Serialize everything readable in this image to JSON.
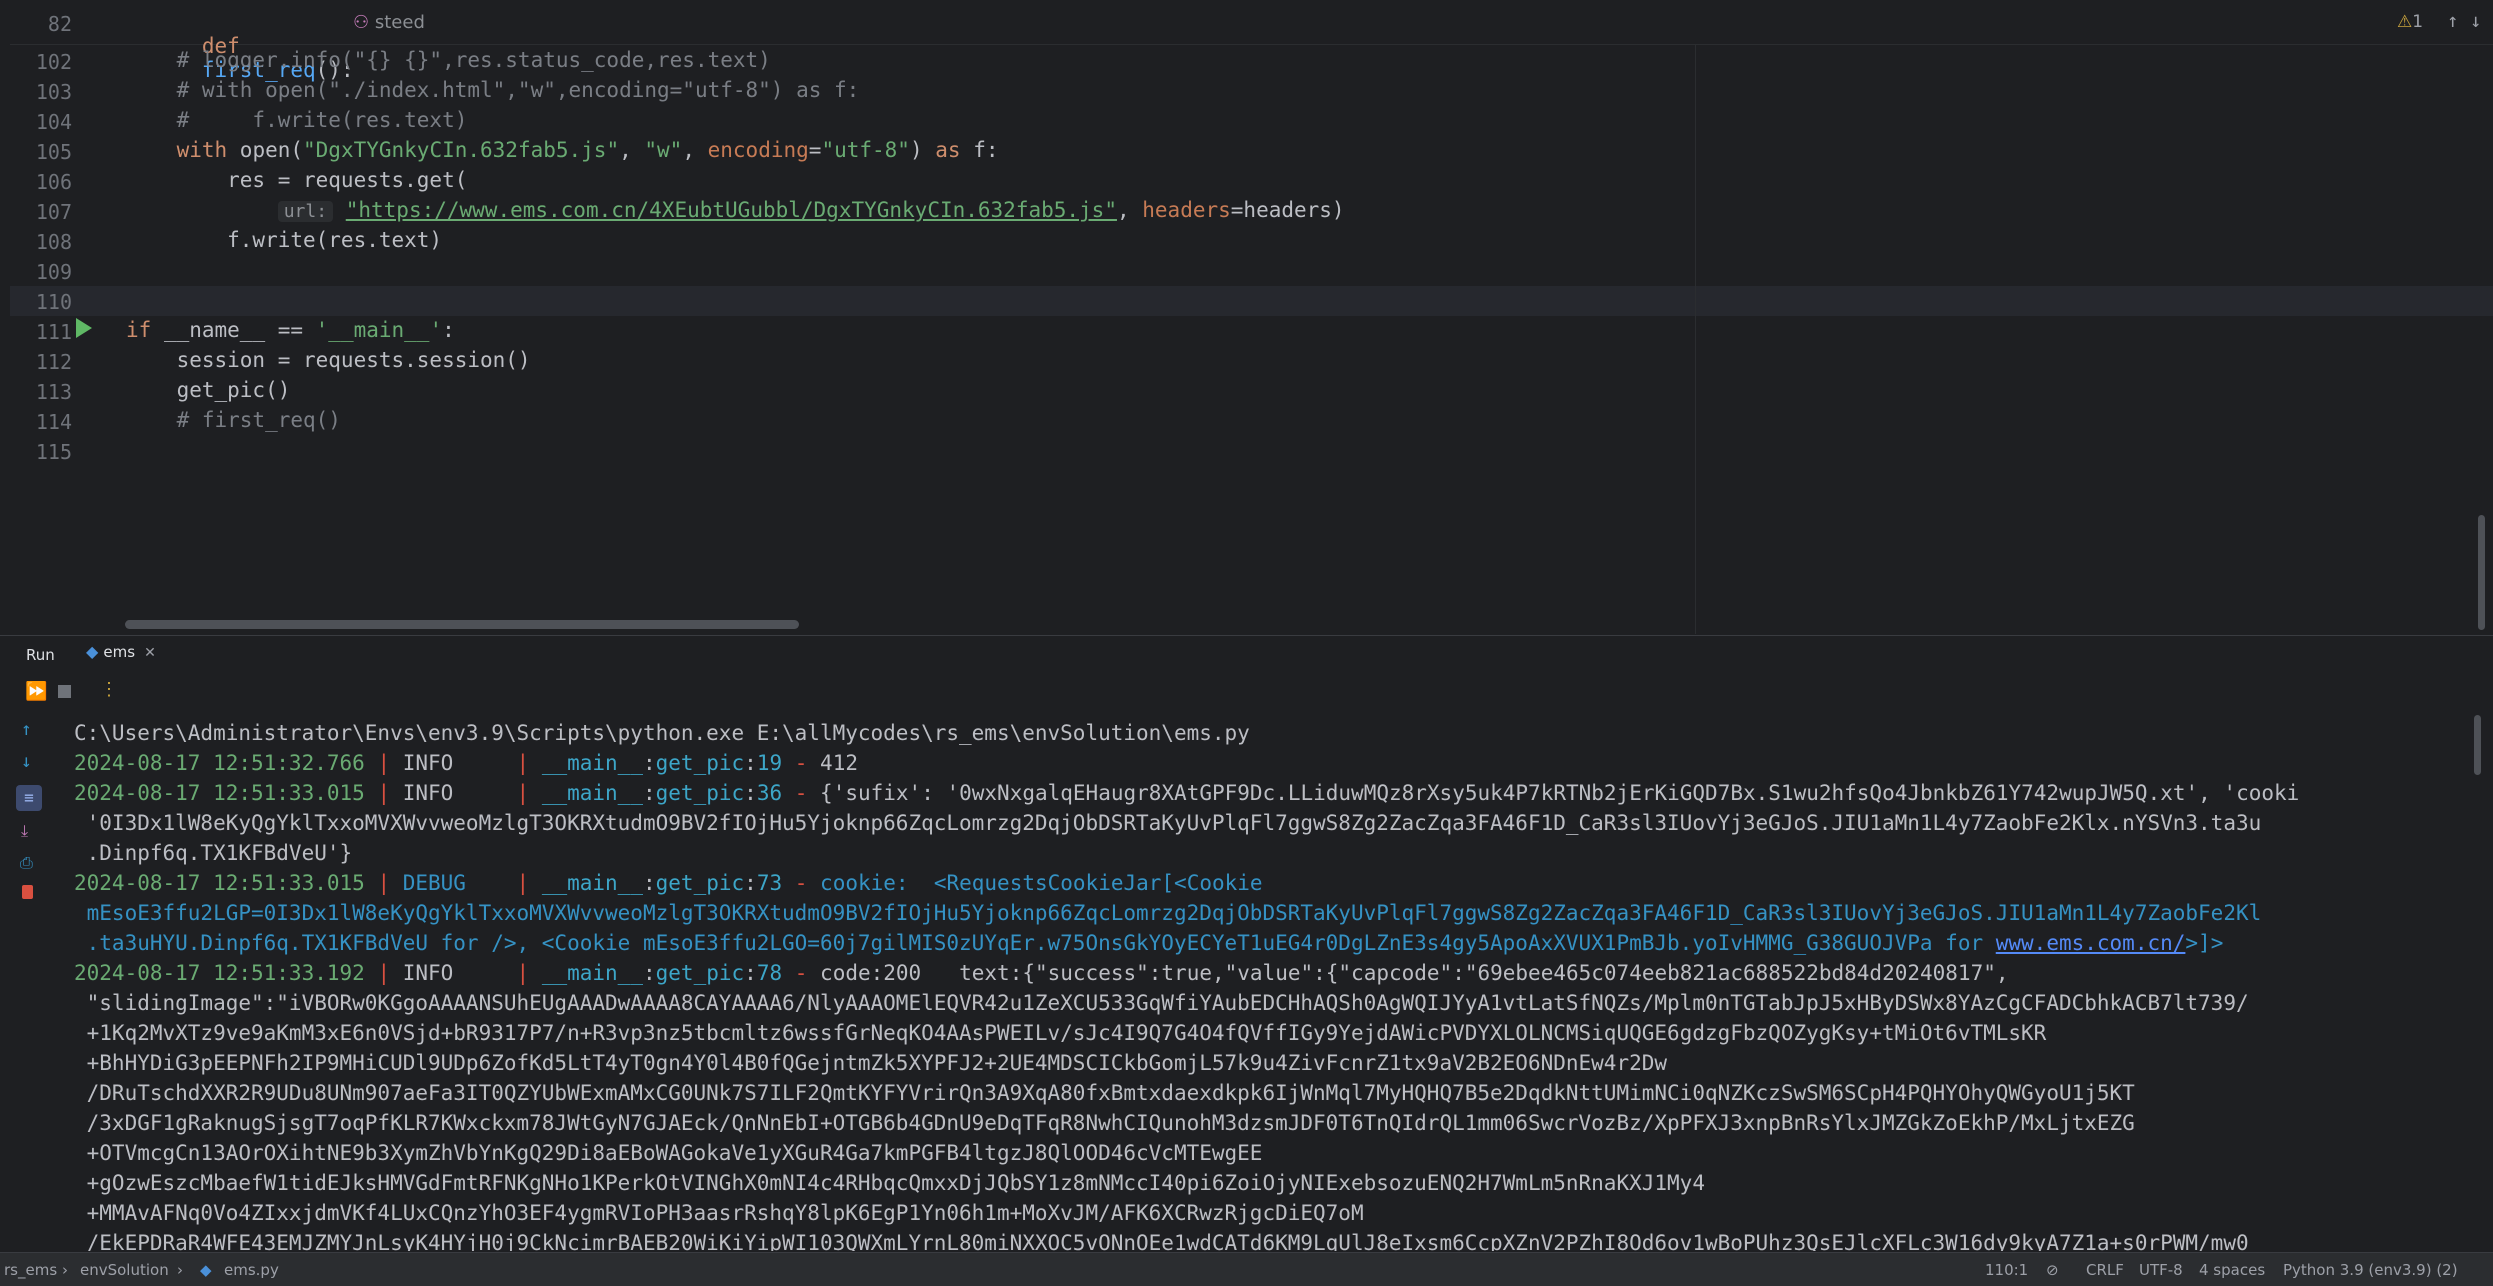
{
  "sticky": {
    "line_number": "82",
    "def_kw": "def",
    "func_name": "first_req",
    "suffix": "():",
    "author": "steed",
    "warning_count": "1"
  },
  "code_lines": [
    {
      "n": "102",
      "parts": [
        {
          "t": "    # logger.info(\"{} {}\",res.status_code,res.text)",
          "c": "cm"
        }
      ]
    },
    {
      "n": "103",
      "parts": [
        {
          "t": "    # with open(\"./index.html\",\"w\",encoding=\"utf-8\") as f:",
          "c": "cm"
        }
      ]
    },
    {
      "n": "104",
      "parts": [
        {
          "t": "    #     f.write(res.text)",
          "c": "cm"
        }
      ]
    },
    {
      "n": "105",
      "parts": [
        {
          "t": "    ",
          "c": ""
        },
        {
          "t": "with ",
          "c": "kw"
        },
        {
          "t": "open(",
          "c": ""
        },
        {
          "t": "\"DgxTYGnkyCIn.632fab5.js\"",
          "c": "str"
        },
        {
          "t": ", ",
          "c": ""
        },
        {
          "t": "\"w\"",
          "c": "str"
        },
        {
          "t": ", ",
          "c": ""
        },
        {
          "t": "encoding",
          "c": "kwarg"
        },
        {
          "t": "=",
          "c": ""
        },
        {
          "t": "\"utf-8\"",
          "c": "str"
        },
        {
          "t": ") ",
          "c": ""
        },
        {
          "t": "as ",
          "c": "kw"
        },
        {
          "t": "f:",
          "c": ""
        }
      ]
    },
    {
      "n": "106",
      "parts": [
        {
          "t": "        res = requests.get(",
          "c": ""
        }
      ]
    },
    {
      "n": "107",
      "parts": [
        {
          "t": "            ",
          "c": ""
        },
        {
          "t": "url:",
          "c": "hint"
        },
        {
          "t": " ",
          "c": ""
        },
        {
          "t": "\"https://www.ems.com.cn/4XEubtUGubbl/DgxTYGnkyCIn.632fab5.js\"",
          "c": "url"
        },
        {
          "t": ", ",
          "c": ""
        },
        {
          "t": "headers",
          "c": "kwarg"
        },
        {
          "t": "=headers)",
          "c": ""
        }
      ]
    },
    {
      "n": "108",
      "parts": [
        {
          "t": "        f.write(res.text)",
          "c": ""
        }
      ]
    },
    {
      "n": "109",
      "parts": []
    },
    {
      "n": "110",
      "parts": []
    },
    {
      "n": "111",
      "parts": [
        {
          "t": "if ",
          "c": "kw"
        },
        {
          "t": "__name__ == ",
          "c": ""
        },
        {
          "t": "'__main__'",
          "c": "str"
        },
        {
          "t": ":",
          "c": ""
        }
      ]
    },
    {
      "n": "112",
      "parts": [
        {
          "t": "    session = requests.session()",
          "c": ""
        }
      ]
    },
    {
      "n": "113",
      "parts": [
        {
          "t": "    get_pic()",
          "c": ""
        }
      ]
    },
    {
      "n": "114",
      "parts": [
        {
          "t": "    # first_req()",
          "c": "cm"
        }
      ]
    },
    {
      "n": "115",
      "parts": []
    }
  ],
  "run_panel": {
    "tab_run": "Run",
    "tab_ems": "ems"
  },
  "console_lines": [
    [
      {
        "t": "C:\\Users\\Administrator\\Envs\\env3.9\\Scripts\\python.exe E:\\allMycodes\\rs_ems\\envSolution\\ems.py",
        "c": ""
      }
    ],
    [
      {
        "t": "2024-08-17 12:51:32.766",
        "c": "ts"
      },
      {
        "t": " | ",
        "c": "sep"
      },
      {
        "t": "INFO    ",
        "c": "lvl"
      },
      {
        "t": " | ",
        "c": "sep"
      },
      {
        "t": "__main__",
        "c": "mod"
      },
      {
        "t": ":",
        "c": ""
      },
      {
        "t": "get_pic",
        "c": "mod"
      },
      {
        "t": ":",
        "c": ""
      },
      {
        "t": "19",
        "c": "mod"
      },
      {
        "t": " - ",
        "c": "sep"
      },
      {
        "t": "412",
        "c": ""
      }
    ],
    [
      {
        "t": "2024-08-17 12:51:33.015",
        "c": "ts"
      },
      {
        "t": " | ",
        "c": "sep"
      },
      {
        "t": "INFO    ",
        "c": "lvl"
      },
      {
        "t": " | ",
        "c": "sep"
      },
      {
        "t": "__main__",
        "c": "mod"
      },
      {
        "t": ":",
        "c": ""
      },
      {
        "t": "get_pic",
        "c": "mod"
      },
      {
        "t": ":",
        "c": ""
      },
      {
        "t": "36",
        "c": "mod"
      },
      {
        "t": " - ",
        "c": "sep"
      },
      {
        "t": "{'sufix': '0wxNxgalqEHaugr8XAtGPF9Dc.LLiduwMQz8rXsy5uk4P7kRTNb2jErKiGQD7Bx.S1wu2hfsQo4JbnkbZ61Y742wupJW5Q.xt', 'cooki",
        "c": ""
      }
    ],
    [
      {
        "t": " '0I3Dx1lW8eKyQgYklTxxoMVXWvvweoMzlgT3OKRXtudmO9BV2fIOjHu5Yjoknp66ZqcLomrzg2DqjObDSRTaKyUvPlqFl7ggwS8Zg2ZacZqa3FA46F1D_CaR3sl3IUovYj3eGJoS.JIU1aMn1L4y7ZaobFe2Klx.nYSVn3.ta3u",
        "c": ""
      }
    ],
    [
      {
        "t": " .Dinpf6q.TX1KFBdVeU'}",
        "c": ""
      }
    ],
    [
      {
        "t": "2024-08-17 12:51:33.015",
        "c": "ts"
      },
      {
        "t": " | ",
        "c": "sep"
      },
      {
        "t": "DEBUG   ",
        "c": "dbg"
      },
      {
        "t": " | ",
        "c": "sep"
      },
      {
        "t": "__main__",
        "c": "mod"
      },
      {
        "t": ":",
        "c": ""
      },
      {
        "t": "get_pic",
        "c": "mod"
      },
      {
        "t": ":",
        "c": ""
      },
      {
        "t": "73",
        "c": "mod"
      },
      {
        "t": " - ",
        "c": "sep"
      },
      {
        "t": "cookie:  <RequestsCookieJar[<Cookie",
        "c": "dbg"
      }
    ],
    [
      {
        "t": " mEsoE3ffu2LGP=0I3Dx1lW8eKyQgYklTxxoMVXWvvweoMzlgT3OKRXtudmO9BV2fIOjHu5Yjoknp66ZqcLomrzg2DqjObDSRTaKyUvPlqFl7ggwS8Zg2ZacZqa3FA46F1D_CaR3sl3IUovYj3eGJoS.JIU1aMn1L4y7ZaobFe2Kl",
        "c": "dbg"
      }
    ],
    [
      {
        "t": " .ta3uHYU.Dinpf6q.TX1KFBdVeU for />, <Cookie mEsoE3ffu2LGO=60j7gilMIS0zUYqEr.w75OnsGkYOyECYeT1uEG4r0DgLZnE3s4gy5ApoAxXVUX1PmBJb.yoIvHMMG_G38GUOJVPa for ",
        "c": "dbg"
      },
      {
        "t": "www.ems.com.cn/",
        "c": "link"
      },
      {
        "t": ">]>",
        "c": "dbg"
      }
    ],
    [
      {
        "t": "2024-08-17 12:51:33.192",
        "c": "ts"
      },
      {
        "t": " | ",
        "c": "sep"
      },
      {
        "t": "INFO    ",
        "c": "lvl"
      },
      {
        "t": " | ",
        "c": "sep"
      },
      {
        "t": "__main__",
        "c": "mod"
      },
      {
        "t": ":",
        "c": ""
      },
      {
        "t": "get_pic",
        "c": "mod"
      },
      {
        "t": ":",
        "c": ""
      },
      {
        "t": "78",
        "c": "mod"
      },
      {
        "t": " - ",
        "c": "sep"
      },
      {
        "t": "code:200   text:{\"success\":true,\"value\":{\"capcode\":\"69ebee465c074eeb821ac688522bd84d20240817\",",
        "c": ""
      }
    ],
    [
      {
        "t": " \"slidingImage\":\"iVBORw0KGgoAAAANSUhEUgAAADwAAAA8CAYAAAA6/NlyAAAOMElEQVR42u1ZeXCU533GqWfiYAubEDCHhAQSh0AgWQIJYyA1vtLatSfNQZs/Mplm0nTGTabJpJ5xHByDSWx8YAzCgCFADCbhkACB7lt739/",
        "c": ""
      }
    ],
    [
      {
        "t": " +1Kq2MvXTz9ve9aKmM3xE6n0VSjd+bR9317P7/n+R3vp3nz5tbcmltz6wssfGrNeqKO4AAsPWEILv/sJc4I9Q7G4O4fQVffIGy9YejdAWicPVDYXLOLNCMSiqUQGE6gdzgFbzQOZygKsy+tMiOt6vTMLsKR",
        "c": ""
      }
    ],
    [
      {
        "t": " +BhHYDiG3pEEPNFh2IP9MHiCUDl9UDp6ZofKd5LtT4yT0gn4Y0l4B0fQGejntmZk5XYPFJ2+2UE4MDSCICkbGomjL57k9u4ZivFcnrZ1tx9aV2B2EO6NDnEw4r2Dw",
        "c": ""
      }
    ],
    [
      {
        "t": " /DRuTschdXXR2R9UDu8UNm907aeFa3IT0QZYUbWExmAMxCG0UNk7S7ILF2QmtKYFYVrirQn3A9XqA80fxBmtxdaexdkpk6IjWnMql7MyHQHQ7B5e2DqdkNttUMimNCi0qNZKczSwSM6SCpH4PQHYOhyQWGyoU1j5KT",
        "c": ""
      }
    ],
    [
      {
        "t": " /3xDGF1gRaknugSjsgT7oqPfKLR7KWxckxm78JWtGyN7GJAEck/QnNnEbI+OTGB6b4GDnU9eDqTFqR8NwhCIQunohM3dzsmJDF0T6TnQIdrQL1mm06SwcrVozBz/XpPFXJ3xnpBnRsYlxJMZGkZoEkhP/MxLjtxEZG",
        "c": ""
      }
    ],
    [
      {
        "t": " +OTVmcgCn13AOrOXihtNE9b3XymZhVbYnKgQ29Di8aEBoWAGokaVe1yXGuR4Ga7kmPGFB4ltgzJ8QlOOD46cVcMTEwgEE",
        "c": ""
      }
    ],
    [
      {
        "t": " +gOzwEszcMbaefW1tidEJksHMVGdFmtRFNKgNHo1KPerkOtVINGhX0mNI4c4RHbqcQmxxDjJQbSY1z8mNMccI40pi6ZoiOjyNIExebsozuENQ2H7WmLm5nRnaKXJ1My4",
        "c": ""
      }
    ],
    [
      {
        "t": " +MMAvAFNq0Vo4ZIxxjdmVKf4LUxCQnzYhO3EF4ygmRVIoPH3aasrRshqY8lpK6EgP1Yn06h1m+MoXvJM/AFK6XCRwzRjgcDiEQ7oM",
        "c": ""
      }
    ],
    [
      {
        "t": " /EkEPDRaR4WFE43EMJZMYJnLsyK4HYjH0j9CkNcimrBAEB20WiKiYipWI103QWXmLYrnL80miNXXOC5vONnOEe1wdCATd6KM9LqUlJ8eIxsm6CcpXZnV2PZhI8Od6ov1wBoPUhz3QsEJlcXFLc3W16dy9kyA7Z1a+s0rPWM/mw0",
        "c": ""
      }
    ]
  ],
  "status_bar": {
    "crumb1": "rs_ems",
    "crumb2": "envSolution",
    "crumb3": "ems.py",
    "position": "110:1",
    "line_sep": "CRLF",
    "encoding": "UTF-8",
    "indent": "4 spaces",
    "interpreter": "Python 3.9 (env3.9) (2)"
  }
}
